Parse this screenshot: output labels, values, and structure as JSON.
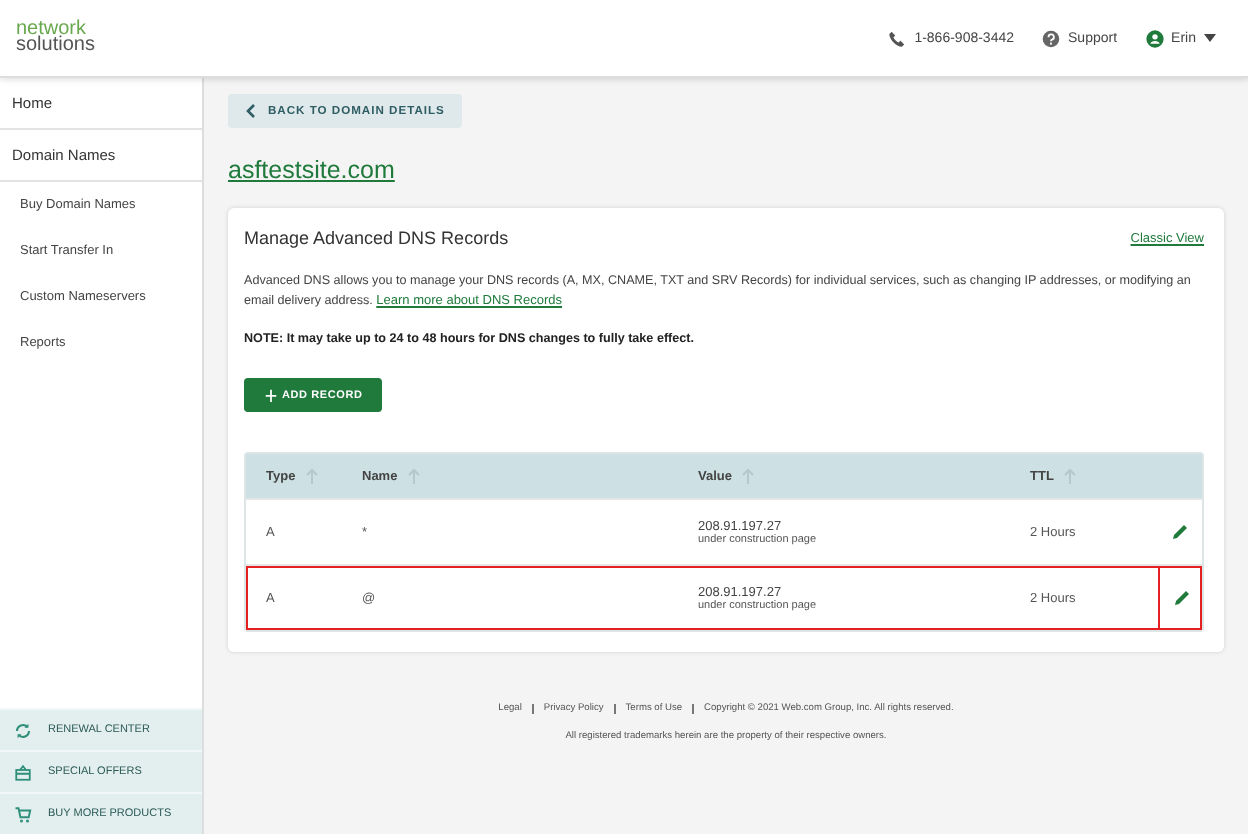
{
  "header": {
    "logo_top": "network",
    "logo_bottom": "solutions",
    "phone": "1-866-908-3442",
    "support": "Support",
    "user": "Erin"
  },
  "sidebar": {
    "items": [
      {
        "label": "Home",
        "kind": "main"
      },
      {
        "label": "Domain Names",
        "kind": "main"
      },
      {
        "label": "Buy Domain Names",
        "kind": "sub"
      },
      {
        "label": "Start Transfer In",
        "kind": "sub"
      },
      {
        "label": "Custom Nameservers",
        "kind": "sub"
      },
      {
        "label": "Reports",
        "kind": "sub"
      }
    ],
    "actions": [
      {
        "label": "RENEWAL CENTER",
        "kind": "renew"
      },
      {
        "label": "SPECIAL OFFERS",
        "kind": "offers"
      },
      {
        "label": "BUY MORE PRODUCTS",
        "kind": "cart"
      }
    ]
  },
  "back_button": "BACK TO DOMAIN DETAILS",
  "domain": "asftestsite.com",
  "card": {
    "title": "Manage Advanced DNS Records",
    "classic_link": "Classic View",
    "description": "Advanced DNS allows you to manage your DNS records (A, MX, CNAME, TXT and SRV Records) for individual services, such as changing IP addresses, or modifying an email delivery address.",
    "learn_link": "Learn more about DNS Records",
    "note": "NOTE: It may take up to 24 to 48 hours for DNS changes to fully take effect.",
    "add_button": "ADD RECORD"
  },
  "table": {
    "columns": [
      "Type",
      "Name",
      "Value",
      "TTL"
    ],
    "rows": [
      {
        "type": "A",
        "name": "*",
        "value": "208.91.197.27",
        "value_note": "under construction page",
        "ttl": "2 Hours",
        "highlighted": false
      },
      {
        "type": "A",
        "name": "@",
        "value": "208.91.197.27",
        "value_note": "under construction page",
        "ttl": "2 Hours",
        "highlighted": true
      }
    ]
  },
  "footer": {
    "links": [
      "Legal",
      "Privacy Policy",
      "Terms of Use"
    ],
    "copyright": "Copyright © 2021 Web.com Group, Inc. All rights reserved.",
    "trademark": "All registered trademarks herein are the property of their respective owners."
  }
}
